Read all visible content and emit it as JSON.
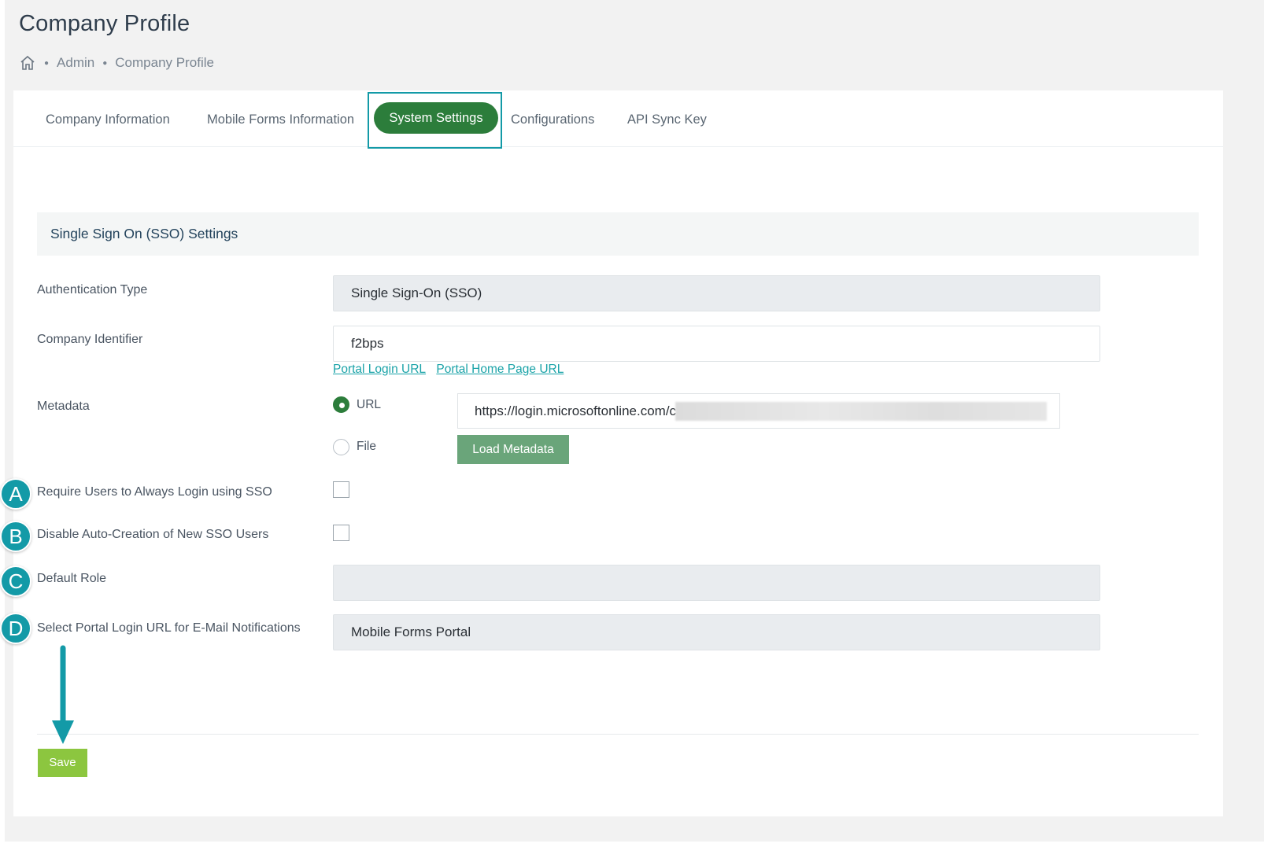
{
  "page": {
    "title": "Company Profile",
    "breadcrumb": [
      "Admin",
      "Company Profile"
    ]
  },
  "tabs": [
    {
      "label": "Company Information",
      "active": false
    },
    {
      "label": "Mobile Forms Information",
      "active": false
    },
    {
      "label": "System Settings",
      "active": true
    },
    {
      "label": "Configurations",
      "active": false
    },
    {
      "label": "API Sync Key",
      "active": false
    }
  ],
  "sso": {
    "section_title": "Single Sign On (SSO) Settings",
    "authentication_type": {
      "label": "Authentication Type",
      "value": "Single Sign-On (SSO)"
    },
    "company_identifier": {
      "label": "Company Identifier",
      "value": "f2bps"
    },
    "links": [
      "Portal Login URL",
      "Portal Home Page URL"
    ],
    "metadata": {
      "label": "Metadata",
      "options": [
        {
          "label": "URL",
          "checked": true
        },
        {
          "label": "File",
          "checked": false
        }
      ],
      "url_value": "https://login.microsoftonline.com/c",
      "load_button": "Load Metadata"
    },
    "require_sso": {
      "label": "Require Users to Always Login using SSO",
      "checked": false
    },
    "disable_auto_creation": {
      "label": "Disable Auto-Creation of New SSO Users",
      "checked": false
    },
    "default_role": {
      "label": "Default Role",
      "value": ""
    },
    "portal_login_url": {
      "label": "Select Portal Login URL for E-Mail Notifications",
      "value": "Mobile Forms Portal"
    }
  },
  "save_label": "Save",
  "markers": [
    "A",
    "B",
    "C",
    "D"
  ],
  "colors": {
    "accent": "#139aa7",
    "active_tab": "#2c7d3b",
    "save_button": "#8cc63f",
    "load_button": "#6aa57a",
    "link": "#1aa3a8"
  },
  "icons": {
    "home": "home-icon",
    "arrow": "arrow-down-annotation"
  }
}
